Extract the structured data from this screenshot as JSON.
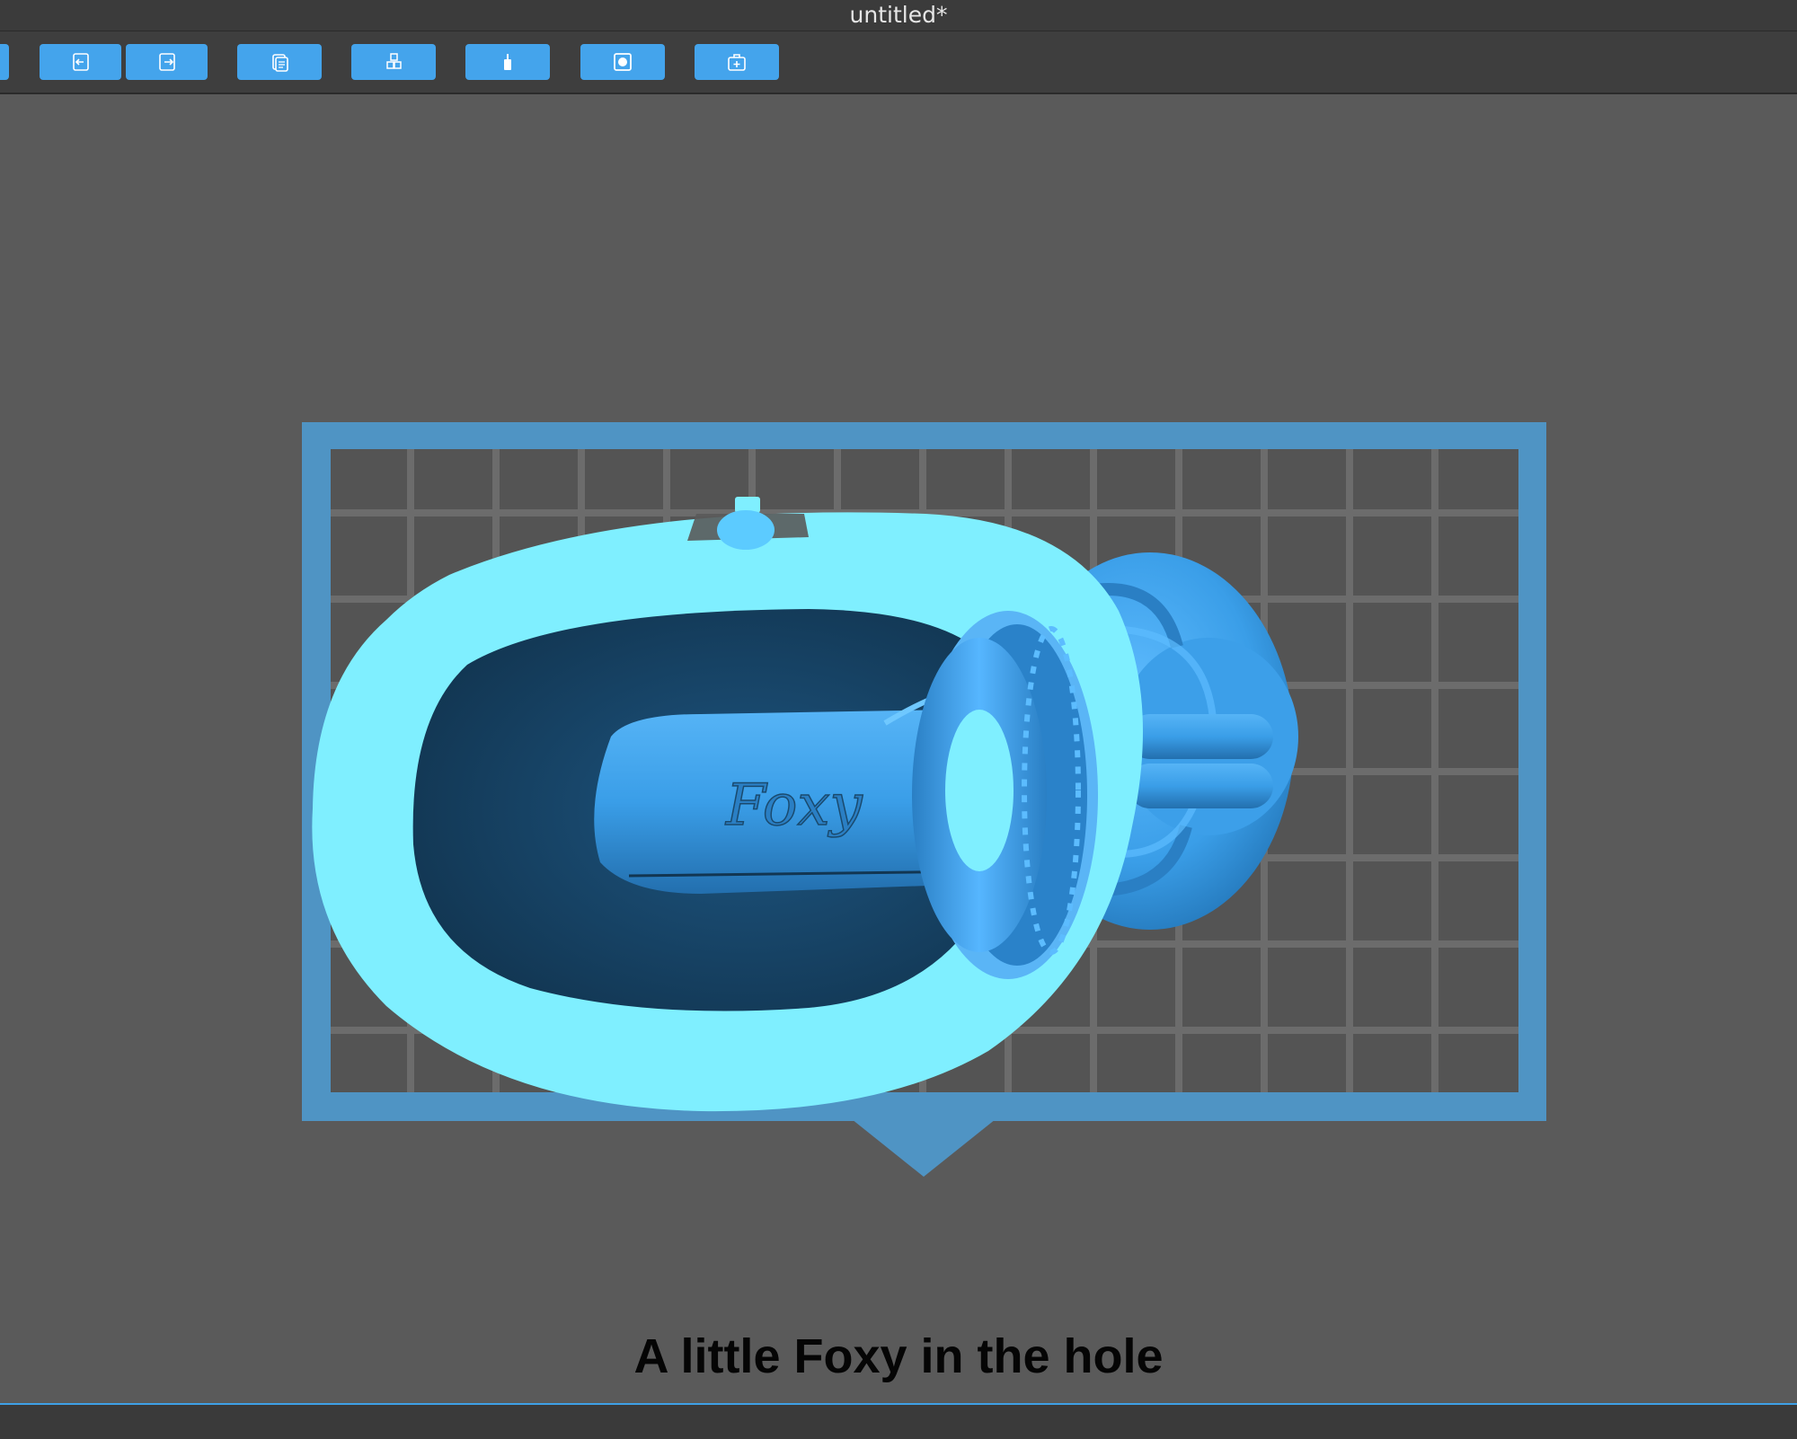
{
  "window": {
    "title": "untitled*"
  },
  "toolbar": {
    "buttons": [
      {
        "name": "open-button",
        "icon": "open-file-icon"
      },
      {
        "name": "import-button",
        "icon": "import-icon"
      },
      {
        "name": "export-button",
        "icon": "export-icon"
      },
      {
        "name": "copy-button",
        "icon": "copy-icon"
      },
      {
        "name": "arrange-button",
        "icon": "cubes-icon"
      },
      {
        "name": "support-button",
        "icon": "support-icon"
      },
      {
        "name": "hollow-button",
        "icon": "hollow-icon"
      },
      {
        "name": "add-button",
        "icon": "add-object-icon"
      }
    ],
    "accent": "#44a4ec"
  },
  "viewport": {
    "model_text": "Foxy",
    "caption": "A little Foxy in the hole",
    "colors": {
      "plate_frame": "#4f94c4",
      "grid_line": "#6c6c6c",
      "grid_cell": "#545454",
      "model_light": "#7fefff",
      "model_mid": "#3aa3f0",
      "model_dark": "#1a4a6e"
    }
  }
}
